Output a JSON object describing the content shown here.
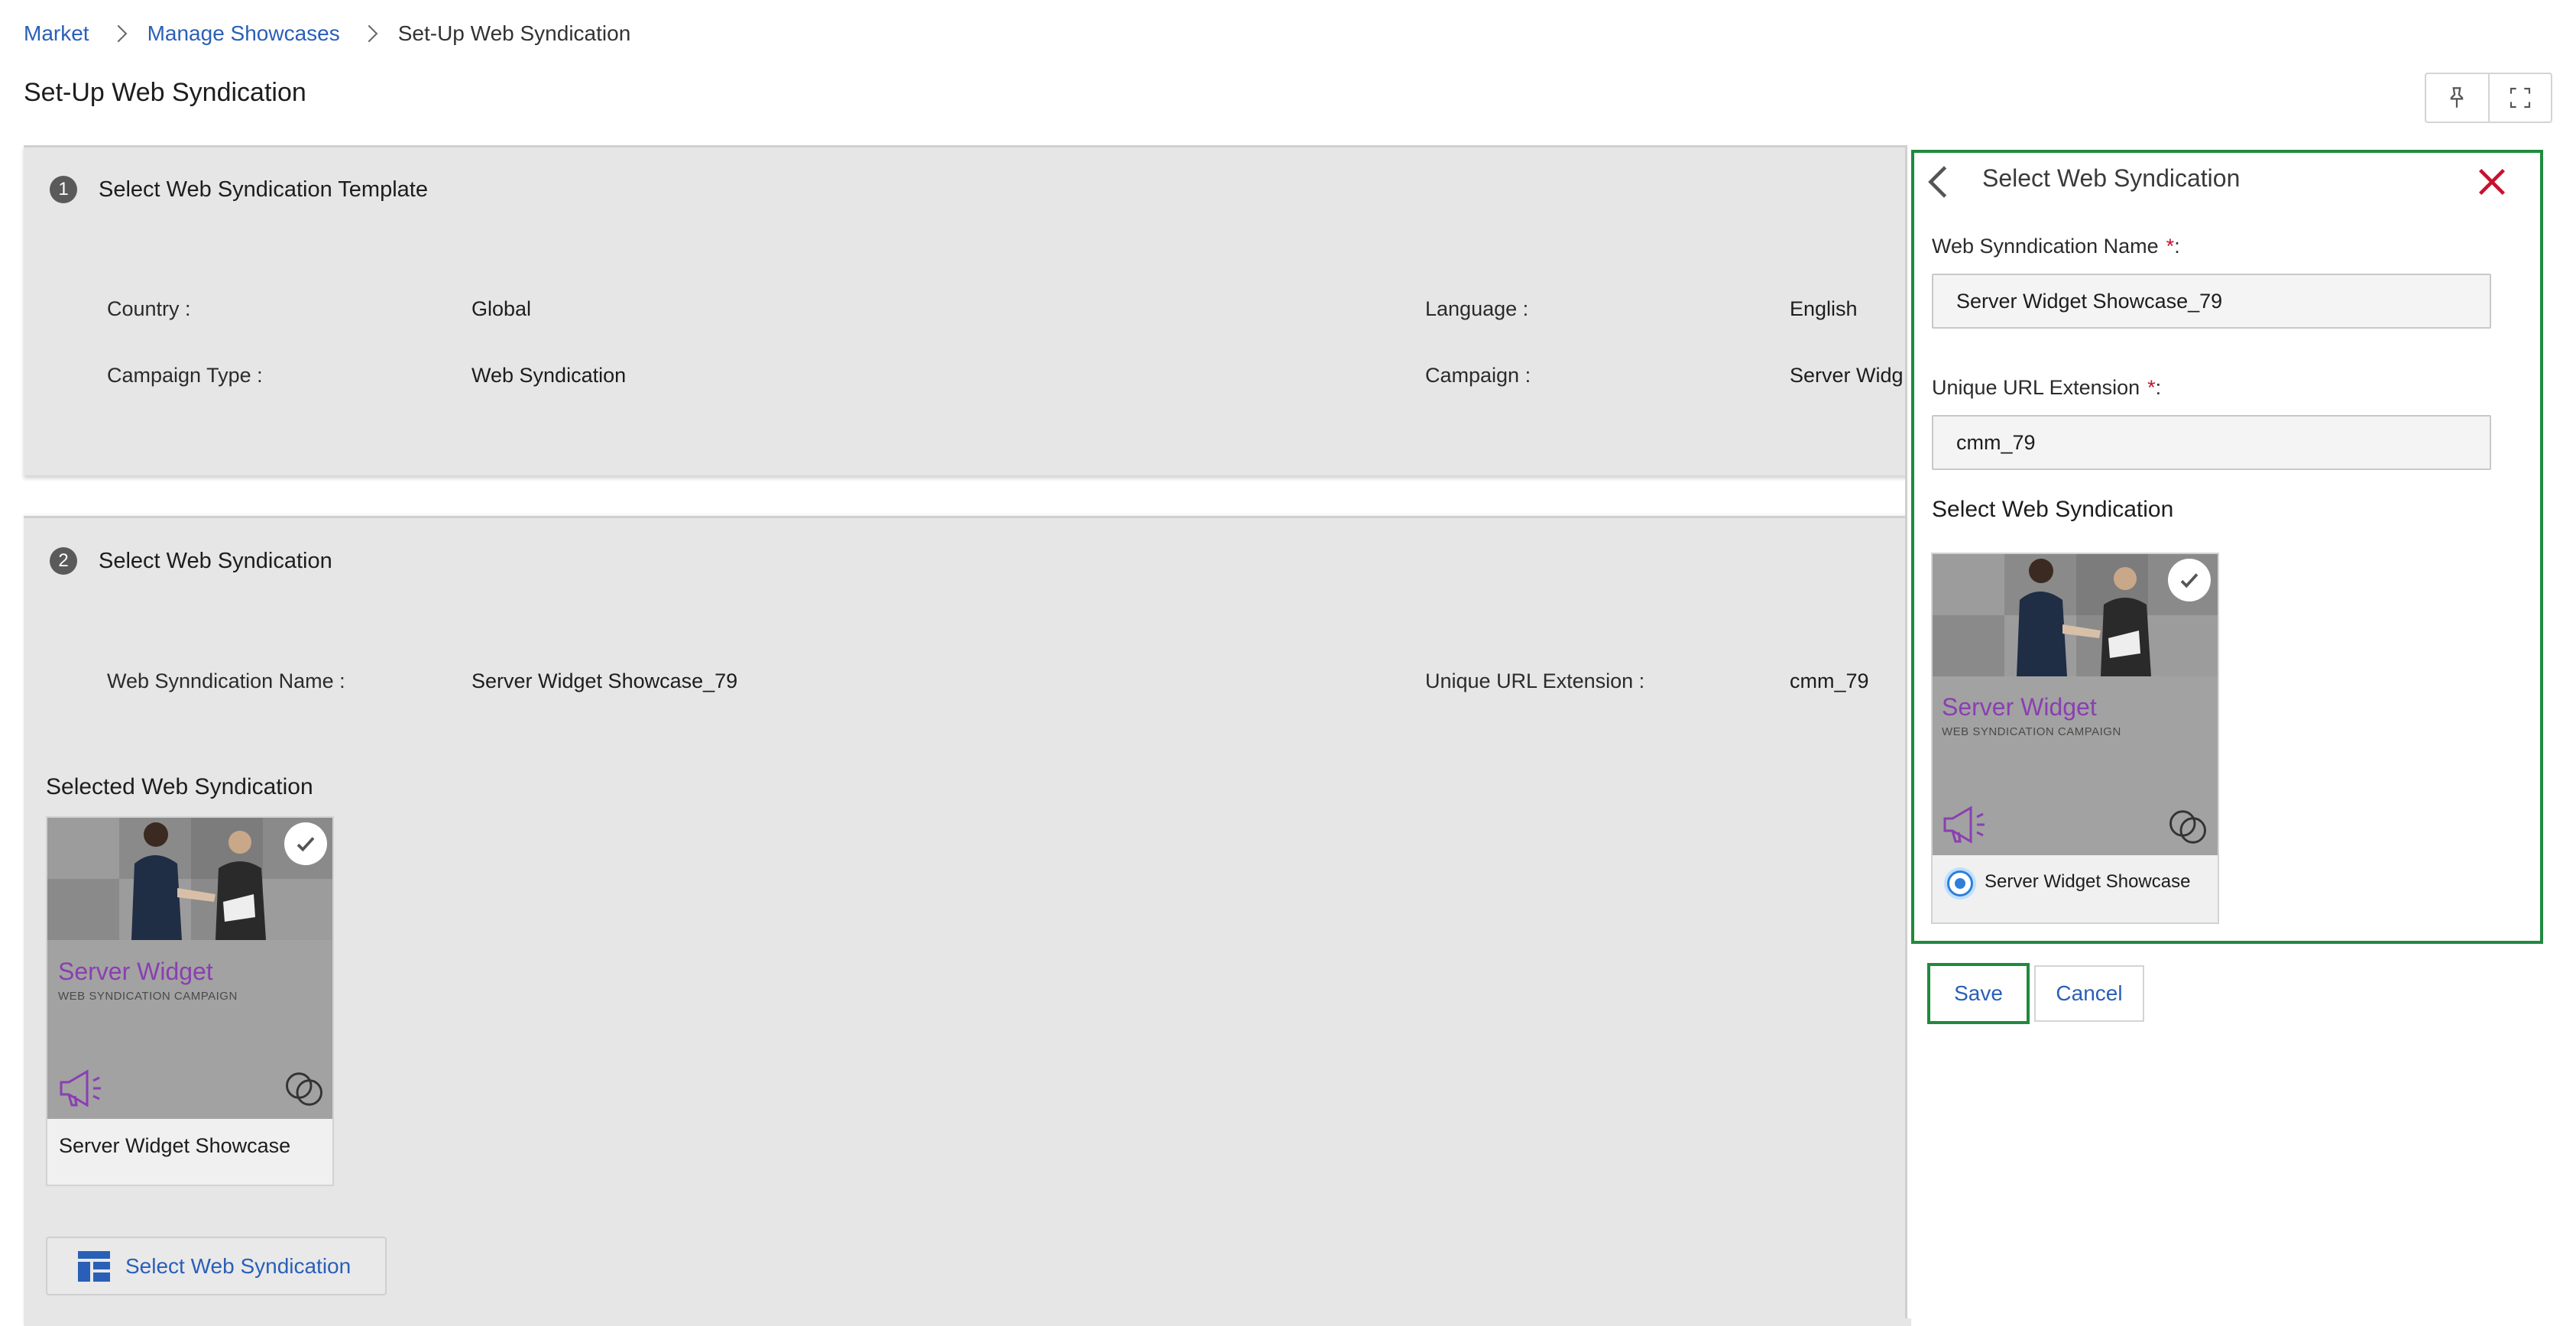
{
  "breadcrumb": {
    "items": [
      "Market",
      "Manage Showcases",
      "Set-Up Web Syndication"
    ]
  },
  "page": {
    "title": "Set-Up Web Syndication"
  },
  "step1": {
    "number": "1",
    "title": "Select Web Syndication Template",
    "country_label": "Country :",
    "country_value": "Global",
    "language_label": "Language :",
    "language_value": "English",
    "campaign_type_label": "Campaign Type :",
    "campaign_type_value": "Web Syndication",
    "campaign_label": "Campaign :",
    "campaign_value": "Server Widg"
  },
  "step2": {
    "number": "2",
    "title": "Select Web Syndication",
    "name_label": "Web Synndication Name :",
    "name_value": "Server Widget Showcase_79",
    "url_label": "Unique URL Extension :",
    "url_value": "cmm_79",
    "selected_title": "Selected Web Syndication",
    "thumb": {
      "name": "Server Widget",
      "subtitle": "WEB SYNDICATION CAMPAIGN",
      "caption": "Server Widget Showcase"
    },
    "select_button": "Select Web Syndication"
  },
  "panel": {
    "title": "Select Web Syndication",
    "name_label": "Web Synndication Name",
    "name_value": "Server Widget Showcase_79",
    "url_label": "Unique URL Extension",
    "url_value": "cmm_79",
    "required_mark": "*",
    "label_suffix": ":",
    "section_title": "Select Web Syndication",
    "thumb": {
      "name": "Server Widget",
      "subtitle": "WEB SYNDICATION CAMPAIGN",
      "option_label": "Server Widget Showcase",
      "selected": true
    },
    "save_label": "Save",
    "cancel_label": "Cancel"
  },
  "colors": {
    "link": "#2a5fb8",
    "highlight_outline": "#1f8a3e",
    "close": "#c8102e",
    "brand_purple": "#8a3fb1",
    "radio": "#2f7fd8"
  }
}
